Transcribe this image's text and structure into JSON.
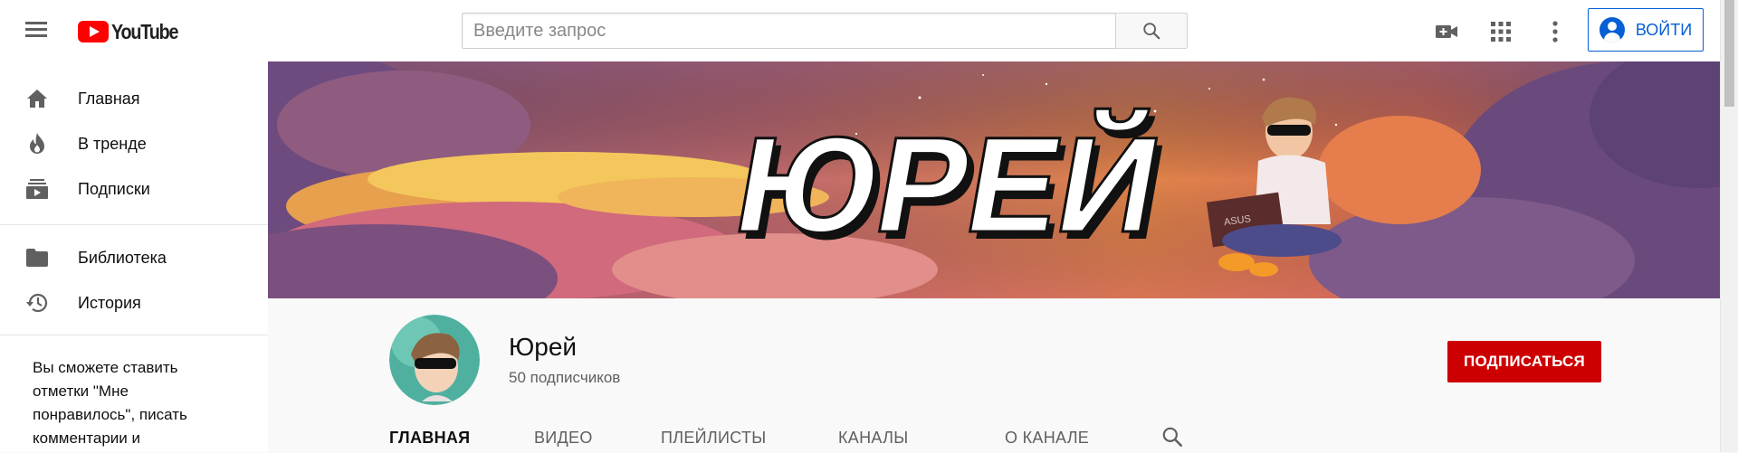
{
  "masthead": {
    "logo_text": "YouTube",
    "search_placeholder": "Введите запрос",
    "signin_label": "ВОЙТИ"
  },
  "sidebar": {
    "items": [
      {
        "label": "Главная",
        "icon": "home-icon"
      },
      {
        "label": "В тренде",
        "icon": "fire-icon"
      },
      {
        "label": "Подписки",
        "icon": "subscriptions-icon"
      },
      {
        "label": "Библиотека",
        "icon": "folder-icon"
      },
      {
        "label": "История",
        "icon": "history-icon"
      }
    ],
    "note": "Вы сможете ставить отметки \"Мне понравилось\", писать комментарии и"
  },
  "banner": {
    "title": "ЮРЕЙ",
    "laptop_text": "ASUS"
  },
  "channel": {
    "name": "Юрей",
    "subscribers": "50 подписчиков",
    "subscribe_label": "ПОДПИСАТЬСЯ"
  },
  "tabs": [
    {
      "label": "ГЛАВНАЯ",
      "active": true
    },
    {
      "label": "ВИДЕО",
      "active": false
    },
    {
      "label": "ПЛЕЙЛИСТЫ",
      "active": false
    },
    {
      "label": "КАНАЛЫ",
      "active": false
    },
    {
      "label": "О КАНАЛЕ",
      "active": false
    }
  ],
  "colors": {
    "brand_red": "#ff0000",
    "subscribe_red": "#cc0000",
    "link_blue": "#065fd4"
  }
}
